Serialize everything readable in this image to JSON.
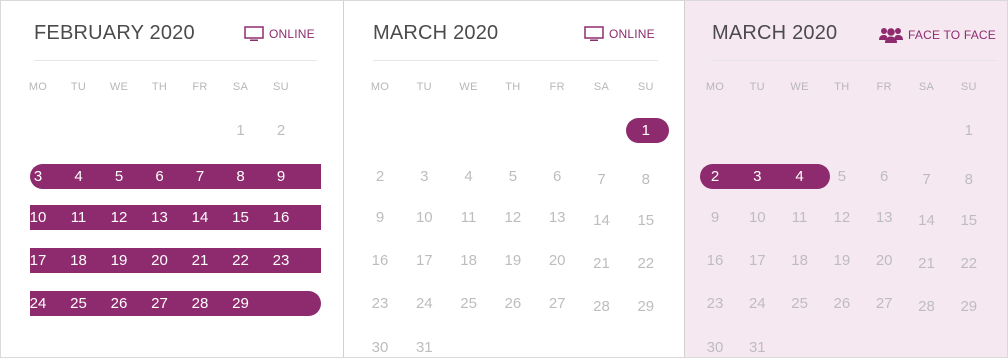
{
  "accent": "#8e2b6e",
  "panels": [
    {
      "title": "FEBRUARY 2020",
      "mode_label": "ONLINE",
      "mode_icon": "monitor-icon",
      "weekdays": [
        "MO",
        "TU",
        "WE",
        "TH",
        "FR",
        "SA",
        "SU"
      ],
      "weeks": [
        [
          "",
          "",
          "",
          "",
          "",
          "1",
          "2"
        ],
        [
          "3",
          "4",
          "5",
          "6",
          "7",
          "8",
          "9"
        ],
        [
          "10",
          "11",
          "12",
          "13",
          "14",
          "15",
          "16"
        ],
        [
          "17",
          "18",
          "19",
          "20",
          "21",
          "22",
          "23"
        ],
        [
          "24",
          "25",
          "26",
          "27",
          "28",
          "29",
          ""
        ]
      ],
      "selected_days": [
        "3",
        "4",
        "5",
        "6",
        "7",
        "8",
        "9",
        "10",
        "11",
        "12",
        "13",
        "14",
        "15",
        "16",
        "17",
        "18",
        "19",
        "20",
        "21",
        "22",
        "23",
        "24",
        "25",
        "26",
        "27",
        "28",
        "29"
      ]
    },
    {
      "title": "MARCH 2020",
      "mode_label": "ONLINE",
      "mode_icon": "monitor-icon",
      "weekdays": [
        "MO",
        "TU",
        "WE",
        "TH",
        "FR",
        "SA",
        "SU"
      ],
      "weeks": [
        [
          "",
          "",
          "",
          "",
          "",
          "",
          "1"
        ],
        [
          "2",
          "3",
          "4",
          "5",
          "6",
          "7",
          "8"
        ],
        [
          "9",
          "10",
          "11",
          "12",
          "13",
          "14",
          "15"
        ],
        [
          "16",
          "17",
          "18",
          "19",
          "20",
          "21",
          "22"
        ],
        [
          "23",
          "24",
          "25",
          "26",
          "27",
          "28",
          "29"
        ],
        [
          "30",
          "31",
          "",
          "",
          "",
          "",
          ""
        ]
      ],
      "selected_days": [
        "1"
      ]
    },
    {
      "title": "MARCH 2020",
      "mode_label": "FACE TO FACE",
      "mode_icon": "people-group-icon",
      "weekdays": [
        "MO",
        "TU",
        "WE",
        "TH",
        "FR",
        "SA",
        "SU"
      ],
      "weeks": [
        [
          "",
          "",
          "",
          "",
          "",
          "",
          "1"
        ],
        [
          "2",
          "3",
          "4",
          "5",
          "6",
          "7",
          "8"
        ],
        [
          "9",
          "10",
          "11",
          "12",
          "13",
          "14",
          "15"
        ],
        [
          "16",
          "17",
          "18",
          "19",
          "20",
          "21",
          "22"
        ],
        [
          "23",
          "24",
          "25",
          "26",
          "27",
          "28",
          "29"
        ],
        [
          "30",
          "31",
          "",
          "",
          "",
          "",
          ""
        ]
      ],
      "selected_days": [
        "2",
        "3",
        "4"
      ]
    }
  ]
}
